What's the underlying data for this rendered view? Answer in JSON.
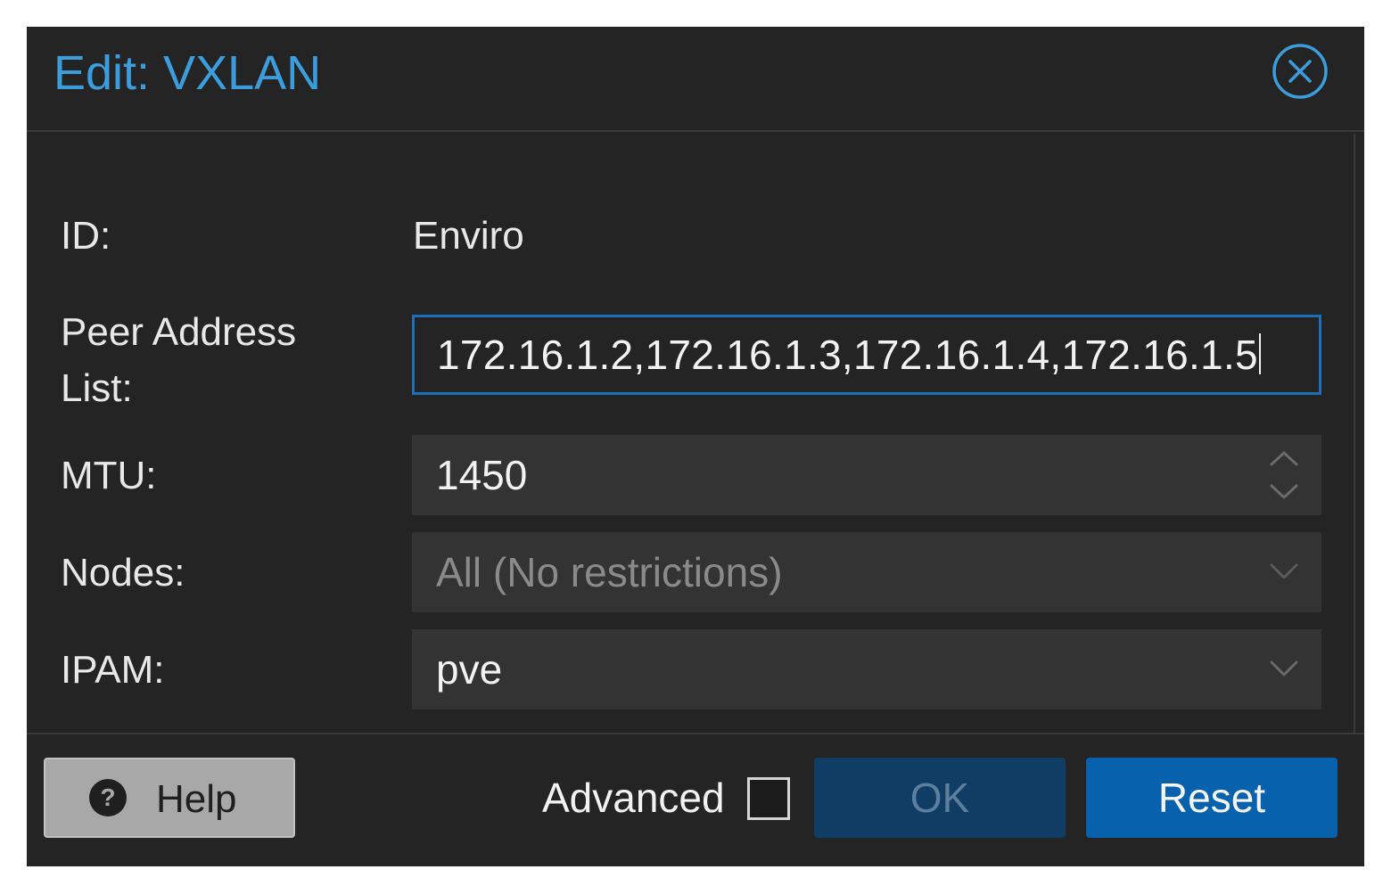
{
  "dialog": {
    "title": "Edit: VXLAN",
    "close_icon": "circle-x-icon"
  },
  "form": {
    "id": {
      "label": "ID:",
      "value": "Enviro"
    },
    "peer_address_list": {
      "label_line1": "Peer Address",
      "label_line2": "List:",
      "value": "172.16.1.2,172.16.1.3,172.16.1.4,172.16.1.5"
    },
    "mtu": {
      "label": "MTU:",
      "value": "1450",
      "trigger_icon": "spinner-arrows-icon"
    },
    "nodes": {
      "label": "Nodes:",
      "value": "All (No restrictions)",
      "trigger_icon": "chevron-down-icon"
    },
    "ipam": {
      "label": "IPAM:",
      "value": "pve",
      "trigger_icon": "chevron-down-icon"
    }
  },
  "footer": {
    "help_label": "Help",
    "help_icon": "question-circle-icon",
    "advanced_label": "Advanced",
    "advanced_checked": false,
    "ok_label": "OK",
    "reset_label": "Reset"
  },
  "colors": {
    "accent": "#3c9ddd",
    "primary_button": "#0761ad",
    "disabled_button": "#0f3d63",
    "background": "#242424",
    "field_background": "#333333",
    "focus_border": "#1d6fb8"
  }
}
